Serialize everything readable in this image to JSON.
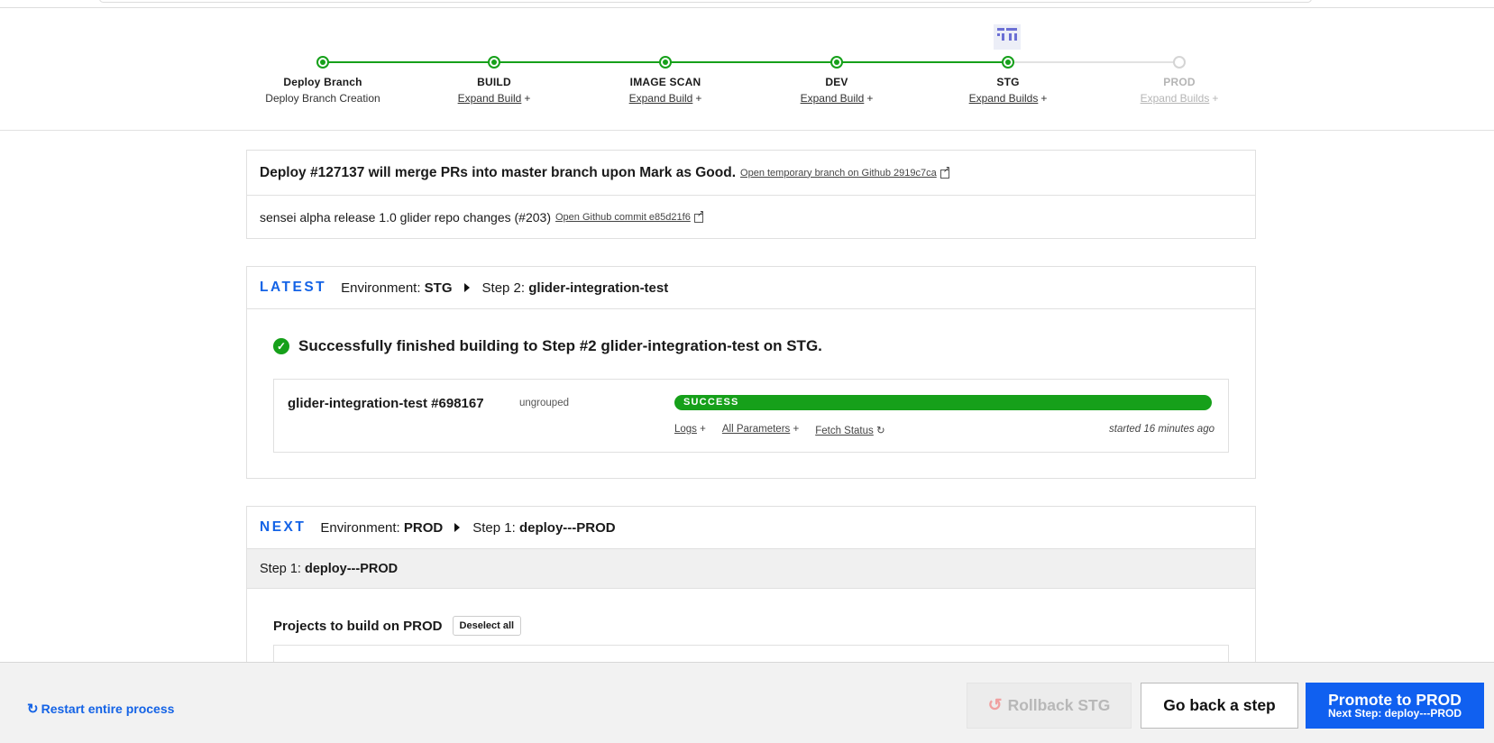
{
  "stepper": {
    "stages": [
      {
        "name": "Deploy Branch",
        "sub": "Deploy Branch Creation",
        "link": false,
        "state": "done"
      },
      {
        "name": "BUILD",
        "sub": "Expand Build",
        "link": true,
        "state": "done"
      },
      {
        "name": "IMAGE SCAN",
        "sub": "Expand Build",
        "link": true,
        "state": "done"
      },
      {
        "name": "DEV",
        "sub": "Expand Build",
        "link": true,
        "state": "done"
      },
      {
        "name": "STG",
        "sub": "Expand Builds",
        "link": true,
        "state": "current"
      },
      {
        "name": "PROD",
        "sub": "Expand Builds",
        "link": true,
        "state": "pending"
      }
    ],
    "plus": "+"
  },
  "deploy": {
    "message": "Deploy #127137 will merge PRs into master branch upon Mark as Good.",
    "branch_link": "Open temporary branch on Github 2919c7ca",
    "commit_message": "sensei alpha release 1.0 glider repo changes (#203)",
    "commit_link": "Open Github commit e85d21f6"
  },
  "latest": {
    "badge": "LATEST",
    "env_label": "Environment:",
    "env": "STG",
    "step_label": "Step 2:",
    "step": "glider-integration-test",
    "success_message": "Successfully finished building to Step #2 glider-integration-test on STG.",
    "job": {
      "name": "glider-integration-test #698167",
      "group": "ungrouped",
      "status": "SUCCESS",
      "links": [
        "Logs",
        "All Parameters",
        "Fetch Status"
      ],
      "started": "started 16 minutes ago"
    }
  },
  "next": {
    "badge": "NEXT",
    "env_label": "Environment:",
    "env": "PROD",
    "step_label": "Step 1:",
    "step": "deploy---PROD",
    "step_bar_label": "Step 1:",
    "step_bar_value": "deploy---PROD",
    "projects_label": "Projects to build on PROD",
    "deselect_label": "Deselect all"
  },
  "footer": {
    "restart_label": "Restart entire process",
    "rollback_label": "Rollback STG",
    "goback_label": "Go back a step",
    "promote_label": "Promote to PROD",
    "promote_sub": "Next Step: deploy---PROD"
  },
  "colors": {
    "success": "#16a01a",
    "accent": "#1463e6",
    "primary_button": "#1060f0"
  },
  "icons": {
    "success": "check-circle-icon",
    "external": "external-link-icon",
    "refresh": "refresh-icon",
    "restart": "restart-icon",
    "rollback": "undo-icon"
  }
}
